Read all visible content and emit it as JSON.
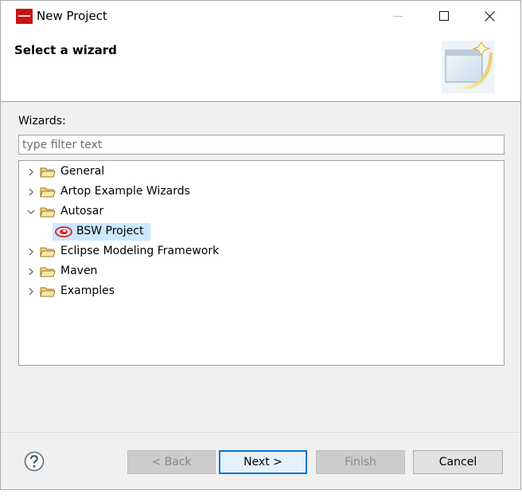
{
  "window": {
    "title": "New Project"
  },
  "banner": {
    "title": "Select a wizard"
  },
  "wizards": {
    "label": "Wizards:",
    "filter_placeholder": "type filter text",
    "filter_value": ""
  },
  "tree": {
    "items": [
      {
        "label": "General",
        "expanded": false,
        "icon": "folder-icon"
      },
      {
        "label": "Artop Example Wizards",
        "expanded": false,
        "icon": "folder-icon"
      },
      {
        "label": "Autosar",
        "expanded": true,
        "icon": "folder-icon",
        "children": [
          {
            "label": "BSW Project",
            "icon": "bsw-project-icon",
            "selected": true
          }
        ]
      },
      {
        "label": "Eclipse Modeling Framework",
        "expanded": false,
        "icon": "folder-icon"
      },
      {
        "label": "Maven",
        "expanded": false,
        "icon": "folder-icon"
      },
      {
        "label": "Examples",
        "expanded": false,
        "icon": "folder-icon"
      }
    ]
  },
  "buttons": {
    "back": "< Back",
    "next": "Next >",
    "finish": "Finish",
    "cancel": "Cancel",
    "help_icon": "help-icon"
  },
  "colors": {
    "selection": "#cce8ff",
    "accent": "#0078d7",
    "app_icon": "#c81414"
  }
}
